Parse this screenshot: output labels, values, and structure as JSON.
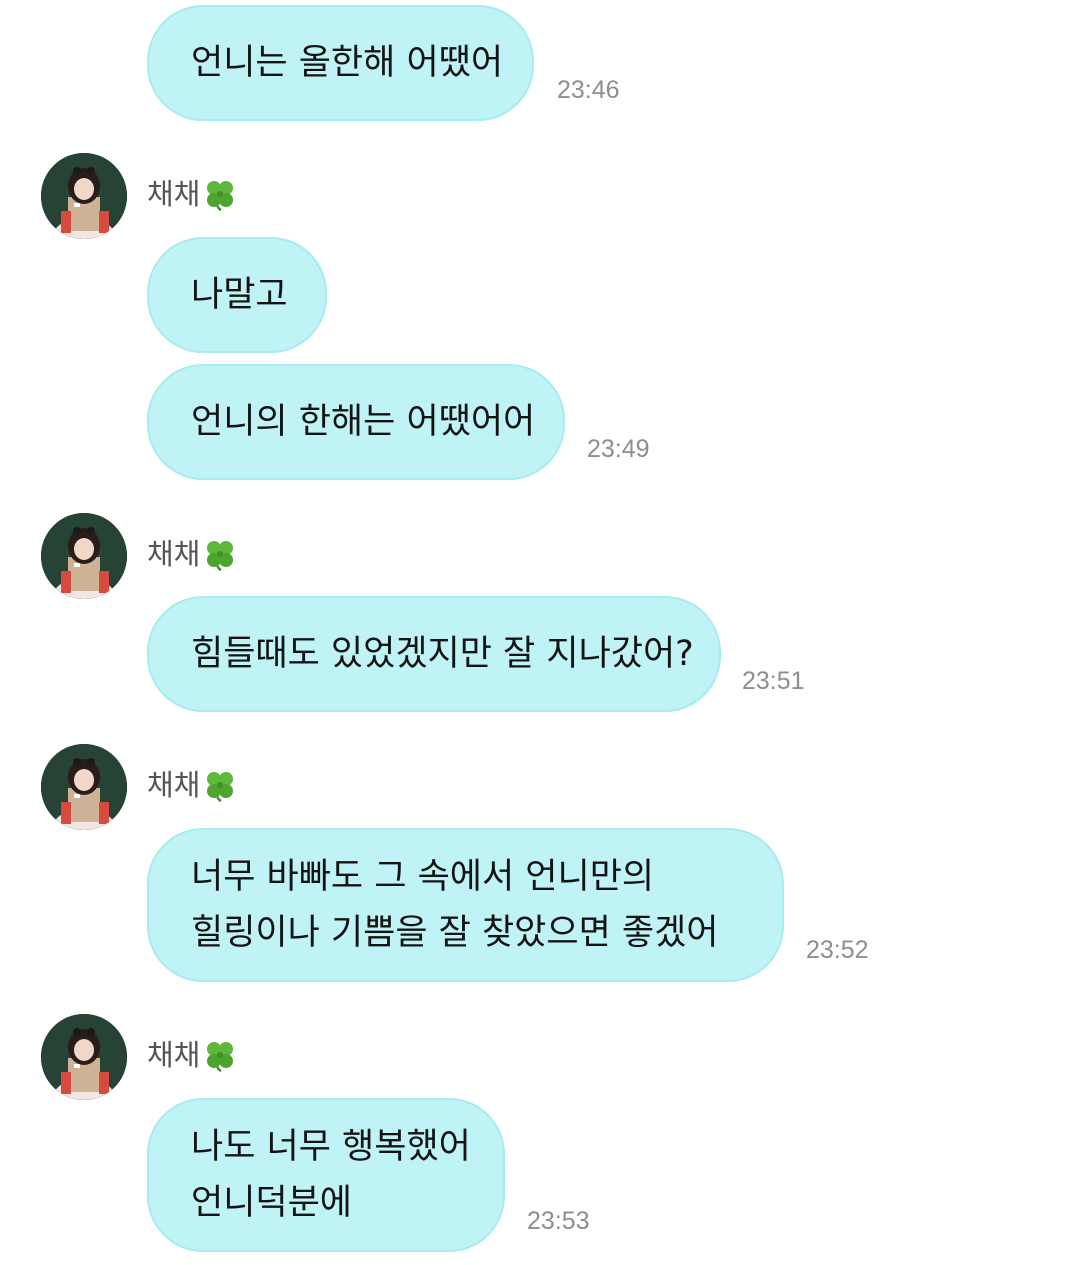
{
  "sender": {
    "name": "채채",
    "name_icon": "four-leaf-clover-icon"
  },
  "messages": [
    {
      "text": "언니는 올한해 어땠어",
      "time": "23:46"
    },
    {
      "text": "나말고",
      "time": ""
    },
    {
      "text": "언니의 한해는 어땠어어",
      "time": "23:49"
    },
    {
      "text": "힘들때도 있었겠지만 잘 지나갔어?",
      "time": "23:51"
    },
    {
      "line1": "너무 바빠도 그 속에서 언니만의",
      "line2": "힐링이나 기쁨을 잘 찾았으면 좋겠어",
      "time": "23:52"
    },
    {
      "line1": "나도 너무 행복했어",
      "line2": "언니덕분에",
      "time": "23:53"
    }
  ],
  "colors": {
    "bubble": "#bff3f6",
    "bubble_border": "#a9ebef",
    "time_text": "#8e8e8e",
    "name_text": "#555555"
  }
}
